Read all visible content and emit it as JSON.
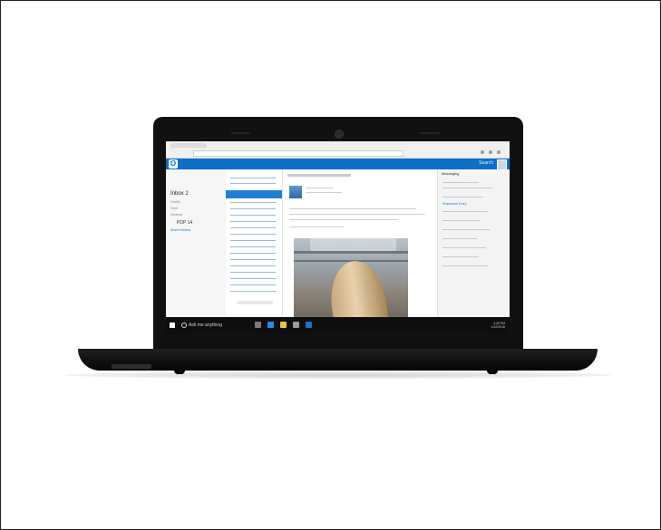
{
  "screen": {
    "app_logo": "O",
    "appbar_right": "Search",
    "inbox_label": "Inbox 2",
    "folders": [
      "Drafts",
      "Sent",
      "Archive"
    ],
    "group_label": "PDP 14",
    "more_link": "More folders",
    "right_pane_title": "Messaging",
    "right_pane_link": "Sharepoint (Hub)",
    "taskbar_search": "Ask me anything",
    "tray_time": "4:45 PM",
    "tray_date": "1/22/2016"
  },
  "colors": {
    "accent": "#0f6fc6",
    "taskbar": "#0e0e0e",
    "laptop_body": "#111111"
  },
  "icons": [
    "start-icon",
    "search-icon",
    "task-view-icon",
    "edge-icon",
    "file-explorer-icon",
    "store-icon",
    "outlook-icon"
  ]
}
